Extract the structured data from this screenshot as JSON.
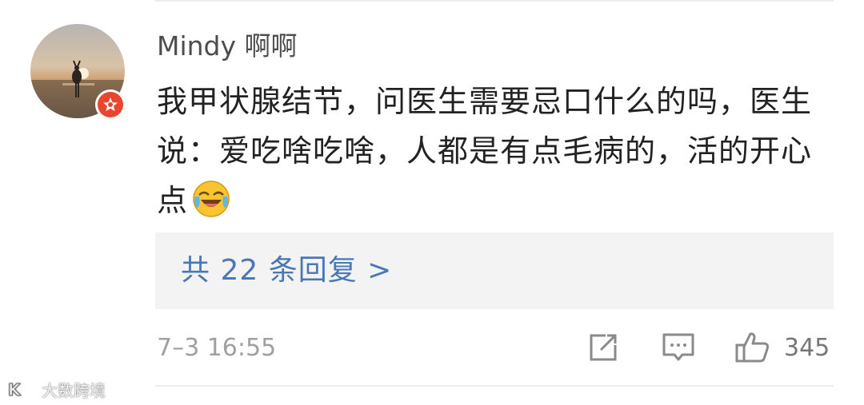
{
  "comment": {
    "username": "Mindy 啊啊",
    "text": "我甲状腺结节，问医生需要忌口什么的吗，医生说：爱吃啥吃啥，人都是有点毛病的，活的开心点",
    "emoji": "laughing-crying-emoji",
    "reply_link": "共 22 条回复 >",
    "timestamp": "7–3 16:55",
    "like_count": "345"
  },
  "icons": {
    "share": "share-icon",
    "comment": "comment-icon",
    "like": "thumbs-up-icon",
    "badge": "vip-badge-icon"
  },
  "watermark": {
    "text": "大数跨境"
  },
  "colors": {
    "link": "#4a78b4",
    "badge": "#e8462f",
    "reply_bg": "#f3f3f3"
  }
}
